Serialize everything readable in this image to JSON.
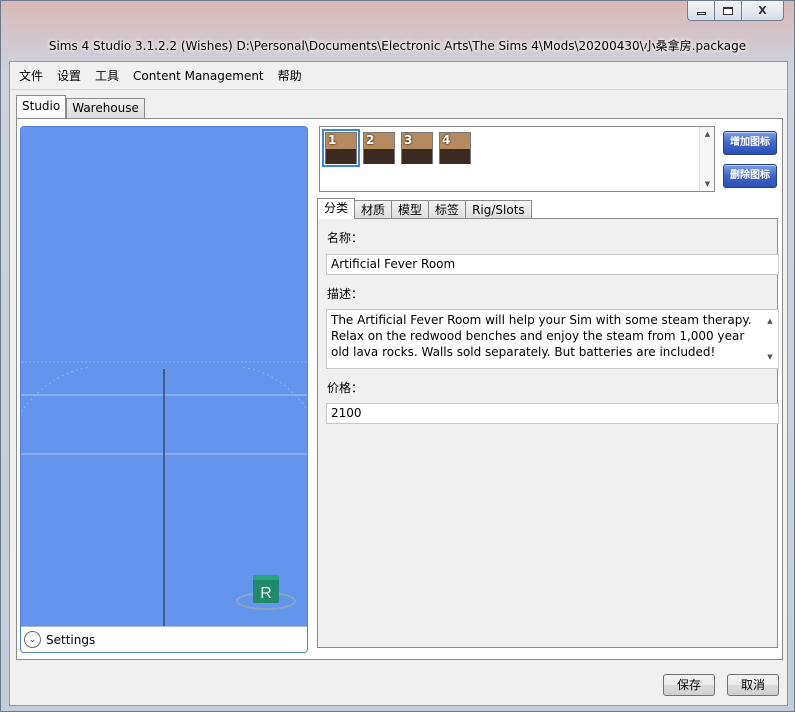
{
  "window": {
    "title": "Sims 4 Studio 3.1.2.2 (Wishes)  D:\\Personal\\Documents\\Electronic Arts\\The Sims 4\\Mods\\20200430\\小桑拿房.package",
    "minimize_glyph": "—",
    "maximize_glyph": "□",
    "close_glyph": "X"
  },
  "menubar": {
    "items": [
      "文件",
      "设置",
      "工具",
      "Content Management",
      "帮助"
    ]
  },
  "top_tabs": [
    "Studio",
    "Warehouse"
  ],
  "viewport": {
    "background_color": "#6495ed",
    "badge_letter": "R",
    "settings_label": "Settings"
  },
  "swatches": {
    "items": [
      "1",
      "2",
      "3",
      "4"
    ],
    "selected": "1",
    "add_label": "增加图标",
    "remove_label": "删除图标"
  },
  "inner_tabs": [
    "分类",
    "材质",
    "模型",
    "标签",
    "Rig/Slots"
  ],
  "form": {
    "name_label": "名称：",
    "name_value": "Artificial Fever Room",
    "desc_label": "描述：",
    "desc_value": "The Artificial Fever Room will help your Sim with some steam therapy. Relax on the redwood benches and enjoy the steam from 1,000 year old lava rocks. Walls sold separately. But batteries are included!",
    "price_label": "价格：",
    "price_value": "2100"
  },
  "footer": {
    "save_label": "保存",
    "cancel_label": "取消"
  }
}
